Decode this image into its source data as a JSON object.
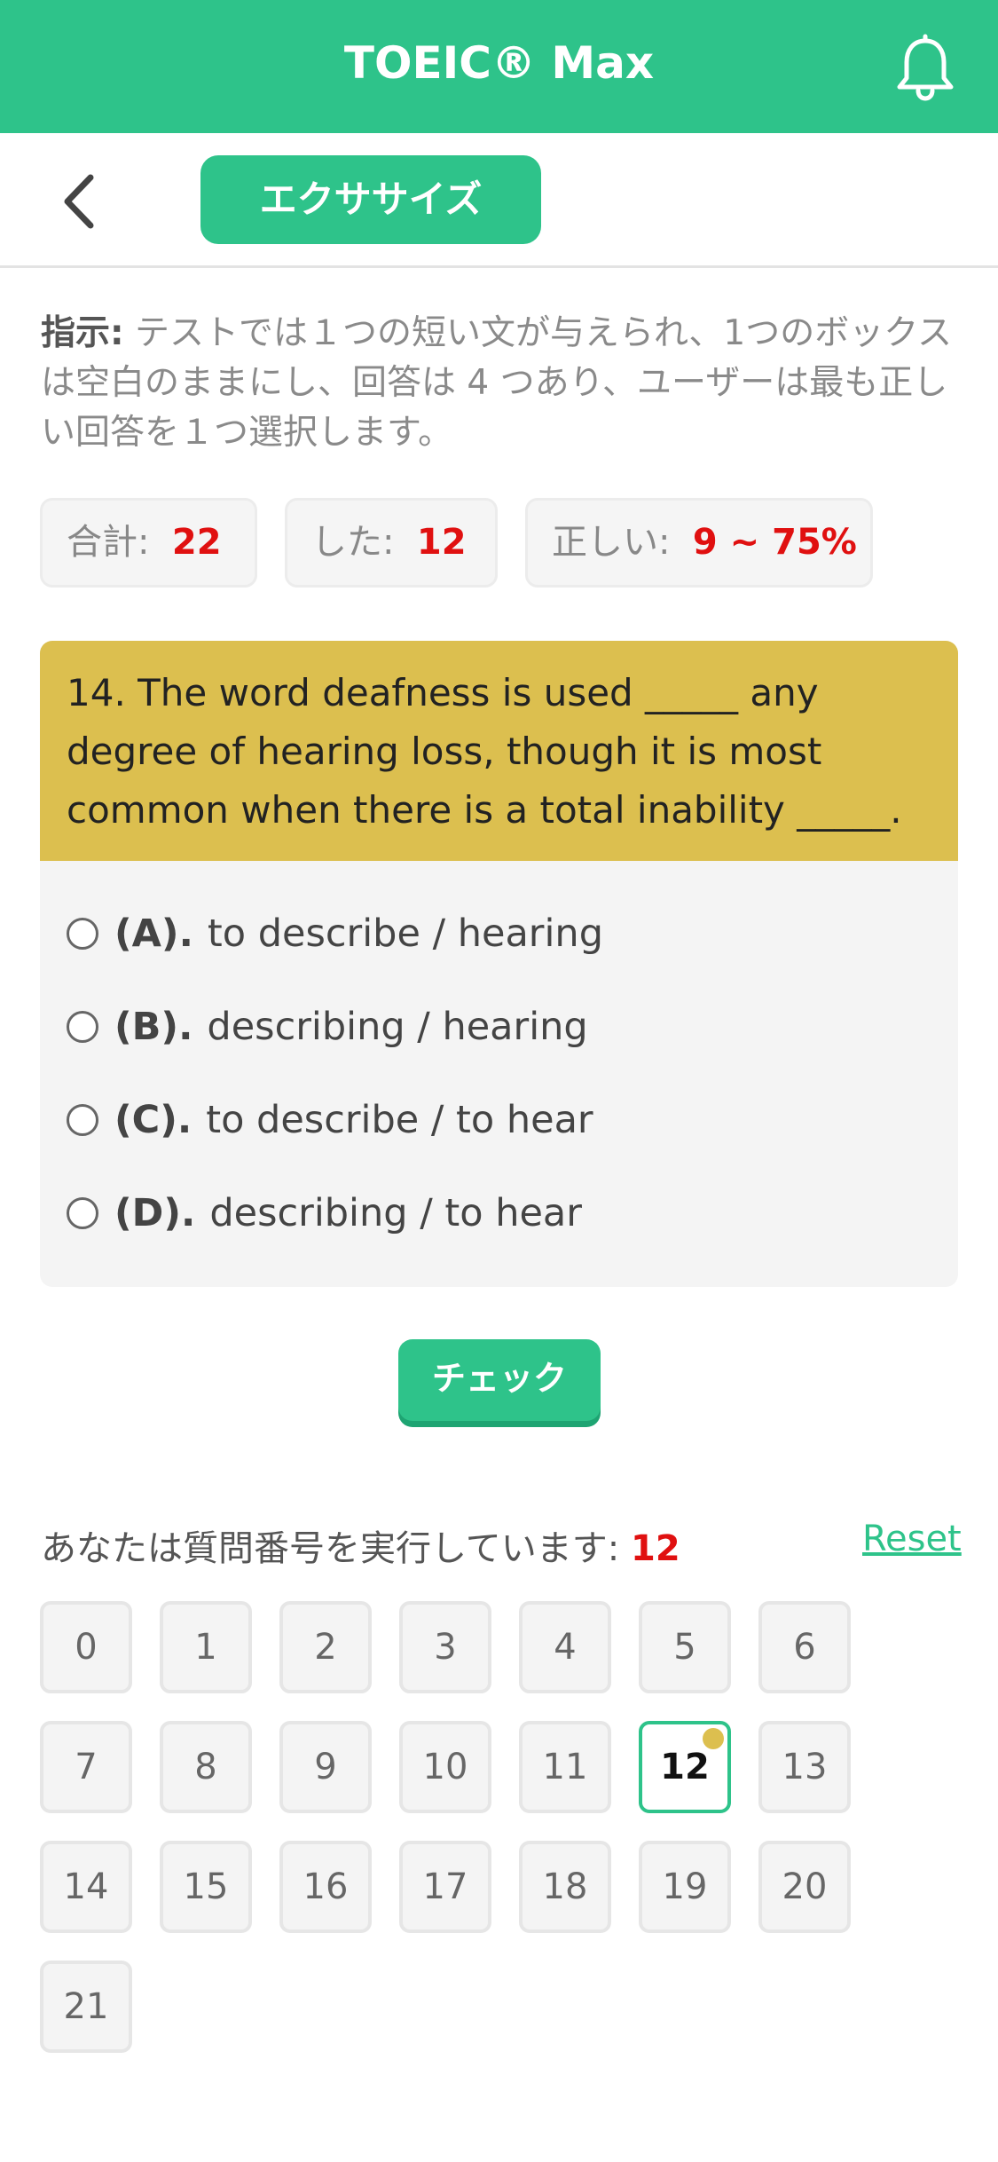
{
  "header": {
    "title": "TOEIC® Max",
    "bell_icon": "bell-icon",
    "color": "#2ec38a"
  },
  "subheader": {
    "back_icon": "chevron-left-icon",
    "tab_label": "エクササイズ"
  },
  "instruction": {
    "label": "指示:",
    "text": " テストでは１つの短い文が与えられ、1つのボックスは空白のままにし、回答は 4 つあり、ユーザーは最も正しい回答を１つ選択します。"
  },
  "stats": {
    "total_label": "合計:",
    "total_value": "22",
    "done_label": "した:",
    "done_value": "12",
    "correct_label": "正しい:",
    "correct_value": "9 ~ 75%"
  },
  "question": {
    "text": "14. The word deafness is used _____ any degree of hearing loss, though it is most common when there is a total inability _____.",
    "header_color": "#dcbf4f",
    "options": [
      {
        "letter": "(A).",
        "text": "to describe / hearing"
      },
      {
        "letter": "(B).",
        "text": "describing / hearing"
      },
      {
        "letter": "(C).",
        "text": "to describe / to hear"
      },
      {
        "letter": "(D).",
        "text": "describing / to hear"
      }
    ]
  },
  "check_button": "チェック",
  "progress": {
    "label": "あなたは質問番号を実行しています: ",
    "current": "12",
    "reset_label": "Reset"
  },
  "question_numbers": [
    "0",
    "1",
    "2",
    "3",
    "4",
    "5",
    "6",
    "7",
    "8",
    "9",
    "10",
    "11",
    "12",
    "13",
    "14",
    "15",
    "16",
    "17",
    "18",
    "19",
    "20",
    "21"
  ]
}
